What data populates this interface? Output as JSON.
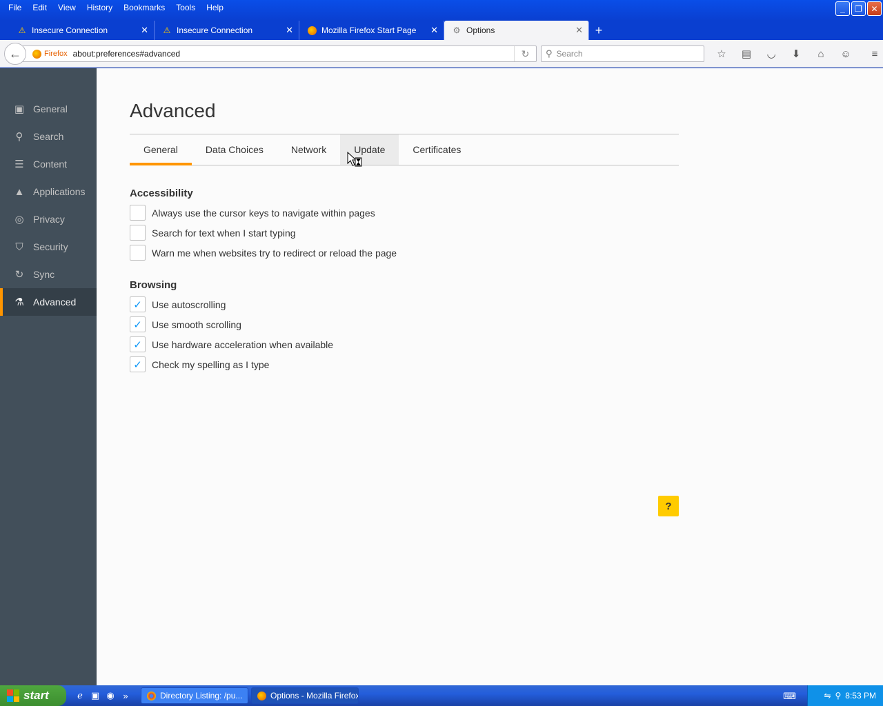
{
  "menu": [
    "File",
    "Edit",
    "View",
    "History",
    "Bookmarks",
    "Tools",
    "Help"
  ],
  "tabs": [
    {
      "title": "Insecure Connection",
      "icon": "warning-icon"
    },
    {
      "title": "Insecure Connection",
      "icon": "warning-icon"
    },
    {
      "title": "Mozilla Firefox Start Page",
      "icon": "firefox-icon"
    },
    {
      "title": "Options",
      "icon": "gear-icon"
    }
  ],
  "navbar": {
    "identity_label": "Firefox",
    "url": "about:preferences#advanced",
    "search_placeholder": "Search"
  },
  "sidebar": {
    "items": [
      {
        "label": "General",
        "icon": "general-icon"
      },
      {
        "label": "Search",
        "icon": "search-icon"
      },
      {
        "label": "Content",
        "icon": "content-icon"
      },
      {
        "label": "Applications",
        "icon": "applications-icon"
      },
      {
        "label": "Privacy",
        "icon": "privacy-mask-icon"
      },
      {
        "label": "Security",
        "icon": "security-icon"
      },
      {
        "label": "Sync",
        "icon": "sync-icon"
      },
      {
        "label": "Advanced",
        "icon": "advanced-icon"
      }
    ],
    "selected": "Advanced"
  },
  "main": {
    "title": "Advanced",
    "subtabs": [
      "General",
      "Data Choices",
      "Network",
      "Update",
      "Certificates"
    ],
    "selected_subtab": "General",
    "accessibility": {
      "title": "Accessibility",
      "options": [
        {
          "label": "Always use the cursor keys to navigate within pages",
          "checked": false
        },
        {
          "label": "Search for text when I start typing",
          "checked": false
        },
        {
          "label": "Warn me when websites try to redirect or reload the page",
          "checked": false
        }
      ]
    },
    "browsing": {
      "title": "Browsing",
      "options": [
        {
          "label": "Use autoscrolling",
          "checked": true
        },
        {
          "label": "Use smooth scrolling",
          "checked": true
        },
        {
          "label": "Use hardware acceleration when available",
          "checked": true
        },
        {
          "label": "Check my spelling as I type",
          "checked": true
        }
      ]
    },
    "help_label": "?"
  },
  "taskbar": {
    "start_label": "start",
    "tasks": [
      "Directory Listing: /pu...",
      "Options - Mozilla Firefox"
    ],
    "clock": "8:53 PM"
  },
  "colors": {
    "accent": "#ff9500",
    "checkmark": "#0996f8",
    "sidebar_bg": "#424f5a"
  }
}
